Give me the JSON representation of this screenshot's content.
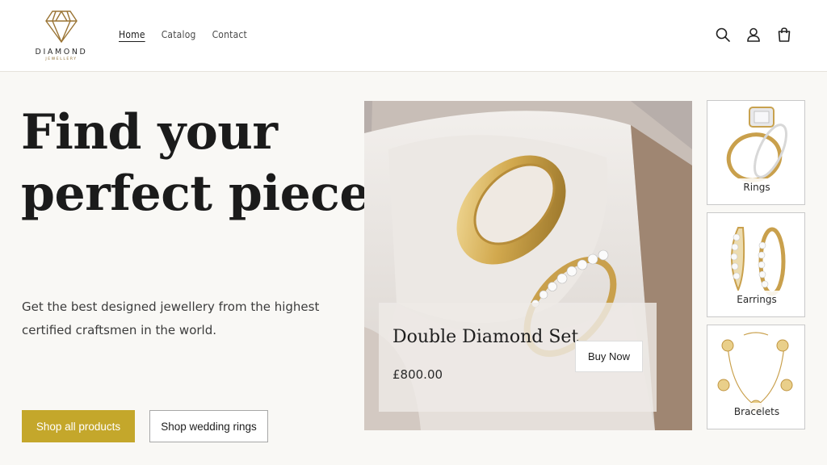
{
  "brand": {
    "name": "DIAMOND",
    "tagline": "JEWELLERY",
    "gold": "#c4a72b"
  },
  "nav": [
    {
      "label": "Home",
      "active": true
    },
    {
      "label": "Catalog",
      "active": false
    },
    {
      "label": "Contact",
      "active": false
    }
  ],
  "header_icons": [
    "search-icon",
    "account-icon",
    "cart-icon"
  ],
  "hero": {
    "title_line1": "Find your",
    "title_line2": "perfect piece",
    "subtitle": "Get the best designed jewellery from the highest certified craftsmen in the world.",
    "primary_button": "Shop all products",
    "secondary_button": "Shop wedding rings"
  },
  "featured": {
    "title": "Double Diamond Set",
    "price": "£800.00",
    "button": "Buy Now"
  },
  "categories": [
    {
      "label": "Rings"
    },
    {
      "label": "Earrings"
    },
    {
      "label": "Bracelets"
    }
  ]
}
